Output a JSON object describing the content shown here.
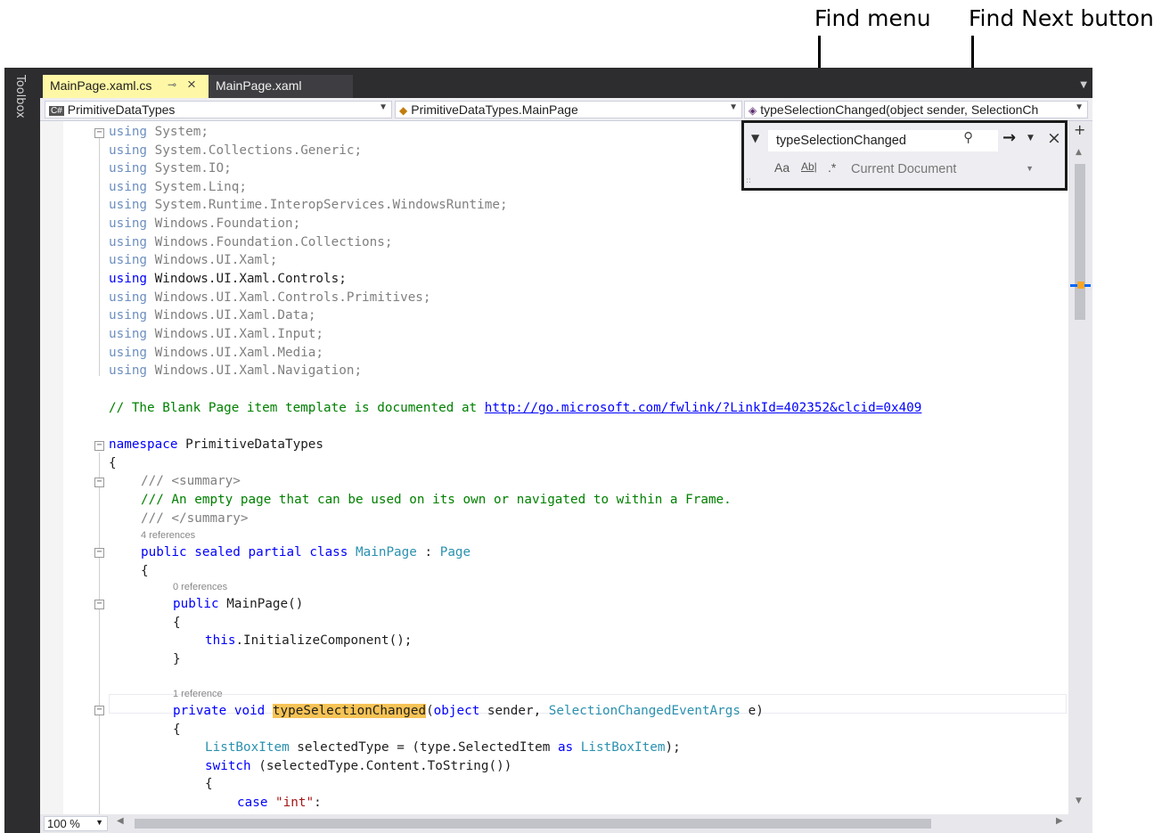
{
  "callouts": {
    "find_menu": "Find menu",
    "find_next_button": "Find Next button"
  },
  "toolbox": {
    "label": "Toolbox"
  },
  "tabs": [
    {
      "label": "MainPage.xaml.cs",
      "active": true
    },
    {
      "label": "MainPage.xaml",
      "active": false
    }
  ],
  "navigation": {
    "project": "PrimitiveDataTypes",
    "class": "PrimitiveDataTypes.MainPage",
    "member": "typeSelectionChanged(object sender, SelectionCh"
  },
  "find": {
    "query": "typeSelectionChanged",
    "options": {
      "match_case": "Aa",
      "whole_word": "Ab|",
      "regex": ".*"
    },
    "scope": "Current Document"
  },
  "code": {
    "usings": [
      "System",
      "System.Collections.Generic",
      "System.IO",
      "System.Linq",
      "System.Runtime.InteropServices.WindowsRuntime",
      "Windows.Foundation",
      "Windows.Foundation.Collections",
      "Windows.UI.Xaml",
      "Windows.UI.Xaml.Controls",
      "Windows.UI.Xaml.Controls.Primitives",
      "Windows.UI.Xaml.Data",
      "Windows.UI.Xaml.Input",
      "Windows.UI.Xaml.Media",
      "Windows.UI.Xaml.Navigation"
    ],
    "comment_prefix": "// The Blank Page item template is documented at ",
    "comment_link": "http://go.microsoft.com/fwlink/?LinkId=402352&clcid=0x409",
    "namespace_kw": "namespace",
    "namespace_name": "PrimitiveDataTypes",
    "summary_open": "/// <summary>",
    "summary_text": "/// An empty page that can be used on its own or navigated to within a Frame.",
    "summary_close": "/// </summary>",
    "refs_class": "4 references",
    "class_decl_kw": "public sealed partial class",
    "class_name": "MainPage",
    "class_colon": " : ",
    "class_base": "Page",
    "refs_ctor": "0 references",
    "ctor_kw": "public",
    "ctor_name": " MainPage()",
    "ctor_this": "this",
    "ctor_body": ".InitializeComponent();",
    "refs_method": "1 reference",
    "method_kw": "private void",
    "method_name": "typeSelectionChanged",
    "method_param_kw": "object",
    "method_param_sender": " sender, ",
    "method_param_type": "SelectionChangedEventArgs",
    "method_param_end": " e)",
    "lbi_type": "ListBoxItem",
    "lbi_mid": " selectedType = (type.SelectedItem ",
    "lbi_as": "as",
    "lbi_type2": "ListBoxItem",
    "lbi_end": ");",
    "switch_kw": "switch",
    "switch_rest": " (selectedType.Content.ToString())",
    "case_kw": "case",
    "case_str": "\"int\"",
    "case_colon": ":"
  },
  "status": {
    "zoom": "100 %"
  }
}
